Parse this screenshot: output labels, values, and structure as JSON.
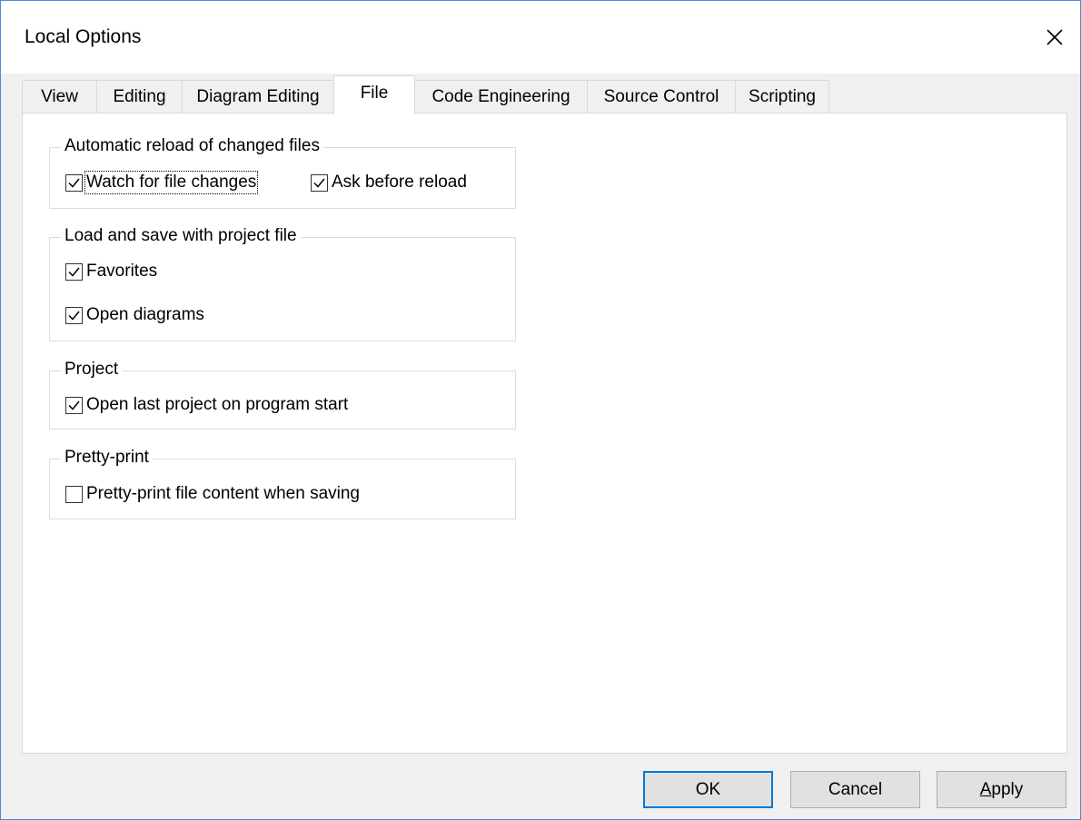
{
  "window": {
    "title": "Local Options"
  },
  "tabs": [
    {
      "label": "View",
      "active": false
    },
    {
      "label": "Editing",
      "active": false
    },
    {
      "label": "Diagram Editing",
      "active": false
    },
    {
      "label": "File",
      "active": true
    },
    {
      "label": "Code Engineering",
      "active": false
    },
    {
      "label": "Source Control",
      "active": false
    },
    {
      "label": "Scripting",
      "active": false
    }
  ],
  "groups": {
    "reload": {
      "legend": "Automatic reload of changed files",
      "watch": {
        "label": "Watch for file changes",
        "checked": true
      },
      "ask": {
        "label": "Ask before reload",
        "checked": true
      }
    },
    "project_file": {
      "legend": "Load and save with project file",
      "favorites": {
        "label": "Favorites",
        "checked": true
      },
      "open_diagrams": {
        "label": "Open diagrams",
        "checked": true
      }
    },
    "project": {
      "legend": "Project",
      "open_last": {
        "label": "Open last project on program start",
        "checked": true
      }
    },
    "pretty": {
      "legend": "Pretty-print",
      "pretty_print": {
        "label": "Pretty-print file content when saving",
        "checked": false
      }
    }
  },
  "buttons": {
    "ok": "OK",
    "cancel": "Cancel",
    "apply_mnemonic": "A",
    "apply_rest": "pply"
  },
  "colors": {
    "accent": "#0078d7",
    "window_border": "#4a8ad6"
  }
}
